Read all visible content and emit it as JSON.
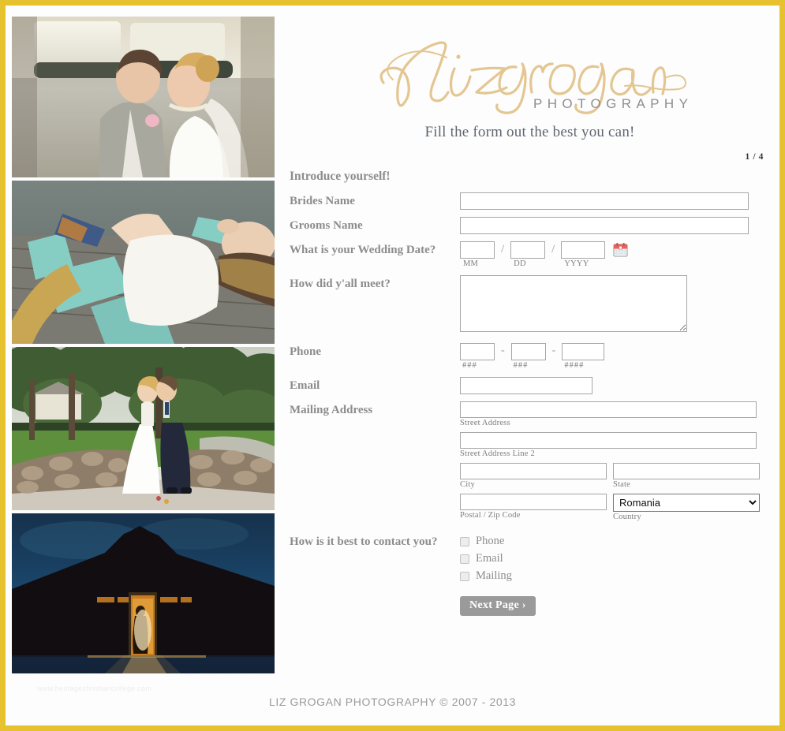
{
  "brand": {
    "logo_text": "lizgrogan",
    "logo_sub": "PHOTOGRAPHY",
    "tagline": "Fill the form out the best you can!",
    "accent_color": "#e3c691",
    "border_color": "#e5c22e"
  },
  "progress": {
    "page_indicator": "1 / 4"
  },
  "form": {
    "section_title": "Introduce yourself!",
    "brides_name": {
      "label": "Brides Name",
      "value": "",
      "placeholder": ""
    },
    "grooms_name": {
      "label": "Grooms Name",
      "value": "",
      "placeholder": ""
    },
    "wedding_date": {
      "label": "What is your Wedding Date?",
      "mm": {
        "value": "",
        "sub": "MM"
      },
      "dd": {
        "value": "",
        "sub": "DD"
      },
      "yyyy": {
        "value": "",
        "sub": "YYYY"
      },
      "separator": "/",
      "icon": "calendar-icon"
    },
    "how_met": {
      "label": "How did y'all meet?",
      "value": ""
    },
    "phone": {
      "label": "Phone",
      "separator": "-",
      "area": {
        "value": "",
        "sub": "###"
      },
      "prefix": {
        "value": "",
        "sub": "###"
      },
      "line": {
        "value": "",
        "sub": "####"
      }
    },
    "email": {
      "label": "Email",
      "value": ""
    },
    "mailing_address": {
      "label": "Mailing Address",
      "street1": {
        "value": "",
        "sub": "Street Address"
      },
      "street2": {
        "value": "",
        "sub": "Street Address Line 2"
      },
      "city": {
        "value": "",
        "sub": "City"
      },
      "state": {
        "value": "",
        "sub": "State"
      },
      "postal": {
        "value": "",
        "sub": "Postal / Zip Code"
      },
      "country": {
        "selected": "Romania",
        "sub": "Country",
        "options": [
          "Romania"
        ]
      }
    },
    "contact_pref": {
      "label": "How is it best to contact you?",
      "options": [
        {
          "label": "Phone",
          "checked": false
        },
        {
          "label": "Email",
          "checked": false
        },
        {
          "label": "Mailing",
          "checked": false
        }
      ]
    },
    "next_button": "Next Page ›"
  },
  "photos": [
    {
      "alt": "Bride and groom in vintage car"
    },
    {
      "alt": "Couple holding hands on dock chairs"
    },
    {
      "alt": "Bride and groom kissing on stone bridge"
    },
    {
      "alt": "Couple silhouetted in lit barn doorway at night"
    }
  ],
  "footer": {
    "copyright": "LIZ GROGAN PHOTOGRAPHY  © 2007 - 2013",
    "watermark": "www.heritagechristiancollege.com"
  }
}
